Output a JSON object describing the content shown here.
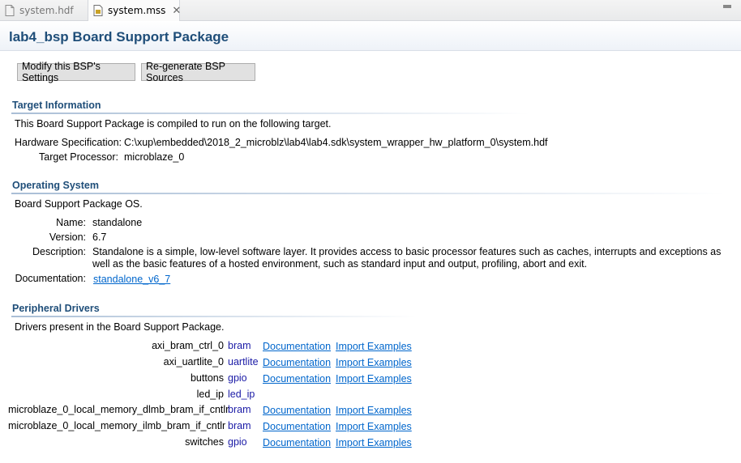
{
  "tabs": [
    {
      "label": "system.hdf",
      "icon": "file-icon",
      "active": false
    },
    {
      "label": "system.mss",
      "icon": "mss-file-icon",
      "active": true
    }
  ],
  "header": {
    "title": "lab4_bsp Board Support Package"
  },
  "buttons": {
    "modify": "Modify this BSP's Settings",
    "regenerate": "Re-generate BSP Sources"
  },
  "target": {
    "title": "Target Information",
    "intro": "This Board Support Package is compiled to run on the following target.",
    "hw_label": "Hardware Specification:",
    "hw_value": "C:\\xup\\embedded\\2018_2_microblz\\lab4\\lab4.sdk\\system_wrapper_hw_platform_0\\system.hdf",
    "proc_label": "Target Processor:",
    "proc_value": "microblaze_0"
  },
  "os": {
    "title": "Operating System",
    "intro": "Board Support Package OS.",
    "name_label": "Name:",
    "name_value": "standalone",
    "version_label": "Version:",
    "version_value": "6.7",
    "desc_label": "Description:",
    "desc_value": "Standalone is a simple, low-level software layer. It provides access to basic processor features such as caches, interrupts and exceptions as well as the basic features of a hosted environment, such as standard input and output, profiling, abort and exit.",
    "doc_label": "Documentation:",
    "doc_link": "standalone_v6_7"
  },
  "drivers": {
    "title": "Peripheral Drivers",
    "intro": "Drivers present in the Board Support Package.",
    "rows": [
      {
        "name": "axi_bram_ctrl_0",
        "driver": "bram",
        "doc": "Documentation",
        "examples": "Import Examples"
      },
      {
        "name": "axi_uartlite_0",
        "driver": "uartlite",
        "doc": "Documentation",
        "examples": "Import Examples"
      },
      {
        "name": "buttons",
        "driver": "gpio",
        "doc": "Documentation",
        "examples": "Import Examples"
      },
      {
        "name": "led_ip",
        "driver": "led_ip",
        "doc": "",
        "examples": ""
      },
      {
        "name": "microblaze_0_local_memory_dlmb_bram_if_cntlr",
        "driver": "bram",
        "doc": "Documentation",
        "examples": "Import Examples"
      },
      {
        "name": "microblaze_0_local_memory_ilmb_bram_if_cntlr",
        "driver": "bram",
        "doc": "Documentation",
        "examples": "Import Examples"
      },
      {
        "name": "switches",
        "driver": "gpio",
        "doc": "Documentation",
        "examples": "Import Examples"
      }
    ]
  },
  "colors": {
    "title": "#1f4e79",
    "link": "#0066cc",
    "driver": "#1a1aa6"
  }
}
